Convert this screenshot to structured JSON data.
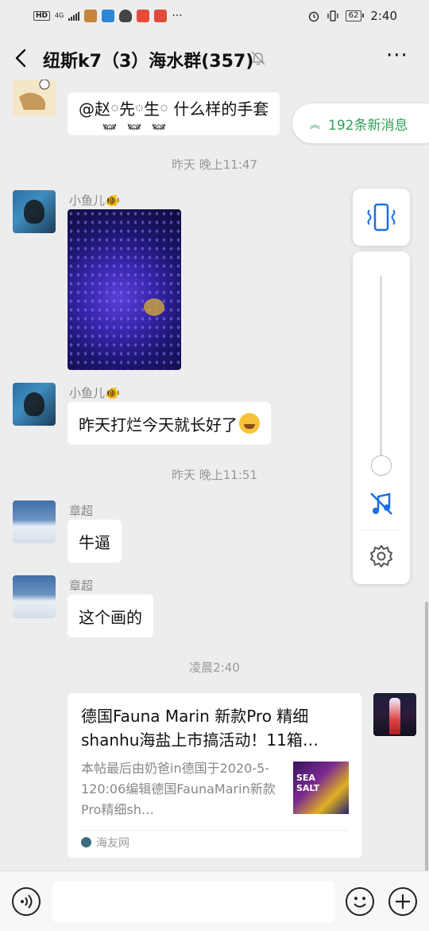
{
  "status_bar": {
    "left_badges": [
      "HD",
      "4G"
    ],
    "time": "2:40",
    "battery": "62"
  },
  "header": {
    "title": "纽斯k7（3）海水群(357)",
    "more": "···"
  },
  "new_messages_pill": {
    "label": "192条新消息"
  },
  "messages": [
    {
      "type": "text",
      "text": "@赵࿆先࿆生࿆ 什么样的手套"
    },
    {
      "type": "timestamp",
      "text": "昨天 晚上11:47"
    },
    {
      "type": "image",
      "sender": "小鱼儿🐠"
    },
    {
      "type": "text",
      "sender": "小鱼儿🐠",
      "text": "昨天打烂今天就长好了"
    },
    {
      "type": "timestamp",
      "text": "昨天 晚上11:51"
    },
    {
      "type": "text",
      "sender": "章超",
      "text": "牛逼"
    },
    {
      "type": "text",
      "sender": "章超",
      "text": "这个画的"
    },
    {
      "type": "timestamp",
      "text": "凌晨2:40"
    },
    {
      "type": "link",
      "title": "德国Fauna Marin 新款Pro 精细shanhu海盐上市搞活动！11箱…",
      "description": "本帖最后由奶爸in德国于2020-5-120:06编辑德国FaunaMarin新款Pro精细sh…",
      "source": "海友网"
    }
  ],
  "icons": {
    "back": "chevron-left-icon",
    "mute": "bell-off-icon",
    "vibrate": "vibrate-icon",
    "music_off": "music-off-icon",
    "settings": "gear-icon",
    "voice": "voice-icon",
    "emoji": "emoji-icon",
    "add": "plus-icon"
  },
  "colors": {
    "accent_green": "#2fa05c",
    "volume_blue": "#1a6fe0",
    "background": "#ededed"
  },
  "volume_level": 0
}
